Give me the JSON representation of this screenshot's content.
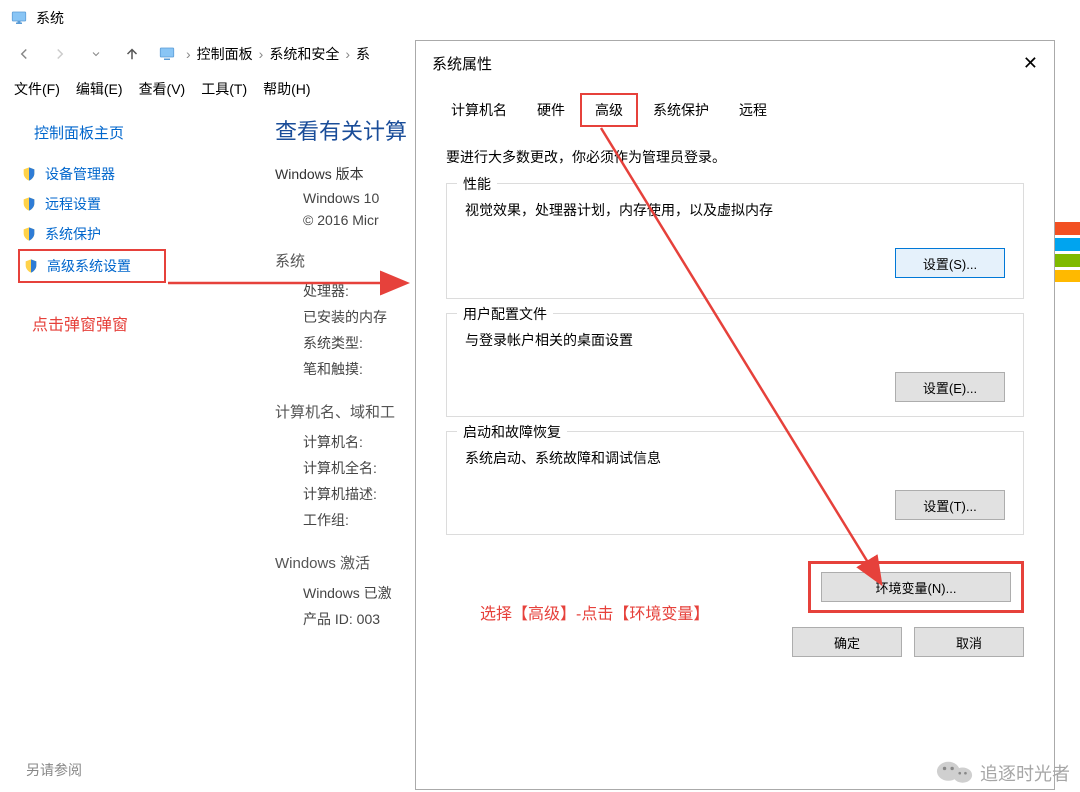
{
  "window": {
    "title": "系统"
  },
  "breadcrumb": {
    "items": [
      "控制面板",
      "系统和安全",
      "系"
    ]
  },
  "menubar": [
    "文件(F)",
    "编辑(E)",
    "查看(V)",
    "工具(T)",
    "帮助(H)"
  ],
  "sidebar": {
    "home": "控制面板主页",
    "items": [
      {
        "label": "设备管理器"
      },
      {
        "label": "远程设置"
      },
      {
        "label": "系统保护"
      },
      {
        "label": "高级系统设置",
        "selected": true
      }
    ],
    "hint": "点击弹窗弹窗"
  },
  "content": {
    "heading": "查看有关计算",
    "edition_label": "Windows 版本",
    "edition_value": "Windows 10",
    "copyright": "© 2016 Micr",
    "system_label": "系统",
    "system_rows": {
      "cpu": "处理器:",
      "ram": "已安装的内存",
      "type": "系统类型:",
      "pen": "笔和触摸:"
    },
    "name_label": "计算机名、域和工",
    "name_rows": {
      "cname": "计算机名:",
      "fname": "计算机全名:",
      "desc": "计算机描述:",
      "wg": "工作组:"
    },
    "activation_label": "Windows 激活",
    "activation_rows": {
      "state": "Windows 已激",
      "pid": "产品 ID: 003"
    }
  },
  "see_also": "另请参阅",
  "dialog": {
    "title": "系统属性",
    "tabs": [
      "计算机名",
      "硬件",
      "高级",
      "系统保护",
      "远程"
    ],
    "active_tab": 2,
    "intro": "要进行大多数更改，你必须作为管理员登录。",
    "groups": [
      {
        "label": "性能",
        "text": "视觉效果，处理器计划，内存使用，以及虚拟内存",
        "button": "设置(S)...",
        "highlight": true
      },
      {
        "label": "用户配置文件",
        "text": "与登录帐户相关的桌面设置",
        "button": "设置(E)..."
      },
      {
        "label": "启动和故障恢复",
        "text": "系统启动、系统故障和调试信息",
        "button": "设置(T)..."
      }
    ],
    "env_button": "环境变量(N)...",
    "ok": "确定",
    "cancel": "取消"
  },
  "annotation": "选择【高级】-点击【环境变量】",
  "watermark": "追逐时光者"
}
